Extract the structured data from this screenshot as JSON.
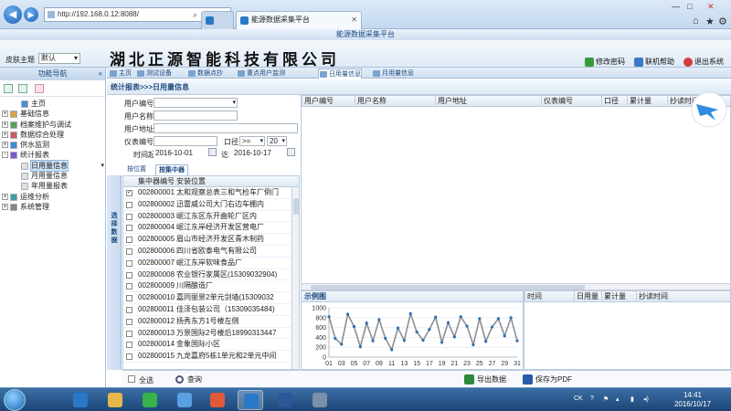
{
  "browser": {
    "url": "http://192.168.0.12:8088/",
    "tab_title": "能源数据采集平台",
    "controls": {
      "search": "⌕",
      "dropdown": "▾",
      "refresh": "↻",
      "stop": "✕"
    },
    "window_controls": {
      "minimize": "—",
      "maximize": "□",
      "close": "✕"
    },
    "home": "⌂",
    "favorites": "★",
    "tools": "⚙"
  },
  "app": {
    "title": "能源数据采集平台",
    "company": "湖北正源智能科技有限公司",
    "skin_label": "皮肤主题",
    "skin_value": "默认",
    "buttons": {
      "change_password": "修改密码",
      "help": "联机帮助",
      "logout": "退出系统"
    }
  },
  "sidebar": {
    "title": "功能导航",
    "collapse": "«",
    "items": [
      {
        "label": "主页",
        "level": 1,
        "expander": "",
        "color": "#4a8fd6"
      },
      {
        "label": "基础信息",
        "level": 0,
        "expander": "+",
        "color": "#d9a441"
      },
      {
        "label": "档案维护与调试",
        "level": 0,
        "expander": "+",
        "color": "#5aa05a"
      },
      {
        "label": "数据综合处理",
        "level": 0,
        "expander": "+",
        "color": "#c75a5a"
      },
      {
        "label": "供水监测",
        "level": 0,
        "expander": "+",
        "color": "#3d8ad4"
      },
      {
        "label": "统计报表",
        "level": 0,
        "expander": "-",
        "color": "#7a5ac7"
      },
      {
        "label": "日用量信息",
        "level": 1,
        "expander": "",
        "color": "#e0e0e0",
        "selected": true
      },
      {
        "label": "月用量信息",
        "level": 1,
        "expander": "",
        "color": "#e0e0e0"
      },
      {
        "label": "年用量报表",
        "level": 1,
        "expander": "",
        "color": "#e0e0e0"
      },
      {
        "label": "运维分析",
        "level": 0,
        "expander": "+",
        "color": "#3da0a0"
      },
      {
        "label": "系统管理",
        "level": 0,
        "expander": "+",
        "color": "#888888"
      }
    ]
  },
  "content_tabs": [
    {
      "label": "主页"
    },
    {
      "label": "测试设备"
    },
    {
      "label": "数据点抄"
    },
    {
      "label": "重点用户监测"
    },
    {
      "label": "日用量信息"
    },
    {
      "label": "月用量信息"
    }
  ],
  "breadcrumb": "统计报表>>>日用量信息",
  "form": {
    "user_no_label": "用户编号",
    "user_name_label": "用户名称",
    "user_addr_label": "用户地址",
    "meter_no_label": "仪表编号",
    "caliber_label": "口径",
    "op_value": ">=",
    "caliber_value": "20",
    "time_label": "时间起",
    "date_from": "2016-10-01",
    "date_to_label": "讫",
    "date_to": "2016-10-17"
  },
  "left_tabs": {
    "install": "按位置",
    "collector": "按集中器"
  },
  "vertical_label": "选择数据",
  "collector_table": {
    "headers": [
      "集中器编号",
      "安装位置"
    ],
    "rows": [
      {
        "id": "002800001",
        "loc": "太和观察总表三和气检车厂倒门",
        "checked": true
      },
      {
        "id": "002800002",
        "loc": "迅雷威公司大门右边车棚内",
        "checked": false
      },
      {
        "id": "002800003",
        "loc": "岷江东区东开曲轮厂区内",
        "checked": false
      },
      {
        "id": "002800004",
        "loc": "岷江东岸经济开发区营电厂",
        "checked": false
      },
      {
        "id": "002800005",
        "loc": "眉山市经济开发区青木制药",
        "checked": false
      },
      {
        "id": "002800006",
        "loc": "四川省欧泰电气有限公司",
        "checked": false
      },
      {
        "id": "002800007",
        "loc": "岷江东岸软味食品厂",
        "checked": false
      },
      {
        "id": "002800008",
        "loc": "农业银行家属区(15309032904)",
        "checked": false
      },
      {
        "id": "002800009",
        "loc": "川隔酿造厂",
        "checked": false
      },
      {
        "id": "002800010",
        "loc": "嘉同丽景2单元剑墙(15309032",
        "checked": false
      },
      {
        "id": "002800011",
        "loc": "佳泽包装公司（15309035484)",
        "checked": false
      },
      {
        "id": "002800012",
        "loc": "扬秀东方1号楼左侧",
        "checked": false
      },
      {
        "id": "002800013",
        "loc": "万景国际2号楼后18990313447",
        "checked": false
      },
      {
        "id": "002800014",
        "loc": "金象国际小区",
        "checked": false
      },
      {
        "id": "002800015",
        "loc": "九龙嘉府5栋1单元和2单元中间",
        "checked": false
      }
    ]
  },
  "bottom": {
    "select_all": "全选",
    "query": "查询",
    "export": "导出数据",
    "save_pdf": "保存为PDF"
  },
  "result_table": {
    "headers": [
      "用户编号",
      "用户名称",
      "用户地址",
      "仪表编号",
      "口径",
      "累计量",
      "抄读时间"
    ]
  },
  "chart_title": "示例图",
  "side_table": {
    "headers": [
      "时间",
      "日用量",
      "累计量",
      "抄读时间"
    ]
  },
  "chart_data": {
    "type": "line",
    "title": "",
    "xlabel": "",
    "ylabel": "",
    "ylim": [
      0,
      1000
    ],
    "yticks": [
      0,
      200,
      400,
      600,
      800,
      1000
    ],
    "xticks": [
      "01",
      "03",
      "05",
      "07",
      "09",
      "11",
      "13",
      "15",
      "17",
      "19",
      "21",
      "23",
      "25",
      "27",
      "29",
      "31"
    ],
    "x": [
      1,
      2,
      3,
      4,
      5,
      6,
      7,
      8,
      9,
      10,
      11,
      12,
      13,
      14,
      15,
      16,
      17,
      18,
      19,
      20,
      21,
      22,
      23,
      24,
      25,
      26,
      27,
      28,
      29,
      30,
      31
    ],
    "series": [
      {
        "values": [
          820,
          380,
          260,
          870,
          620,
          210,
          690,
          330,
          760,
          380,
          150,
          590,
          340,
          880,
          510,
          340,
          560,
          810,
          300,
          700,
          410,
          820,
          630,
          250,
          780,
          320,
          610,
          780,
          430,
          800,
          330
        ]
      }
    ]
  },
  "taskbar": {
    "clock_time": "14:41",
    "clock_date": "2016/10/17",
    "lang": "CK",
    "apps": [
      {
        "name": "ie-icon",
        "color": "#2a78c8"
      },
      {
        "name": "folder-icon",
        "color": "#e6b84a"
      },
      {
        "name": "iqiyi-icon",
        "color": "#37b34a"
      },
      {
        "name": "bird-icon",
        "color": "#5aa0e0"
      },
      {
        "name": "apps-icon",
        "color": "#e05a3a"
      },
      {
        "name": "ie-icon",
        "color": "#2a78c8",
        "active": true
      },
      {
        "name": "word-icon",
        "color": "#2b5797"
      },
      {
        "name": "tool-icon",
        "color": "#7a8fa8"
      }
    ]
  }
}
